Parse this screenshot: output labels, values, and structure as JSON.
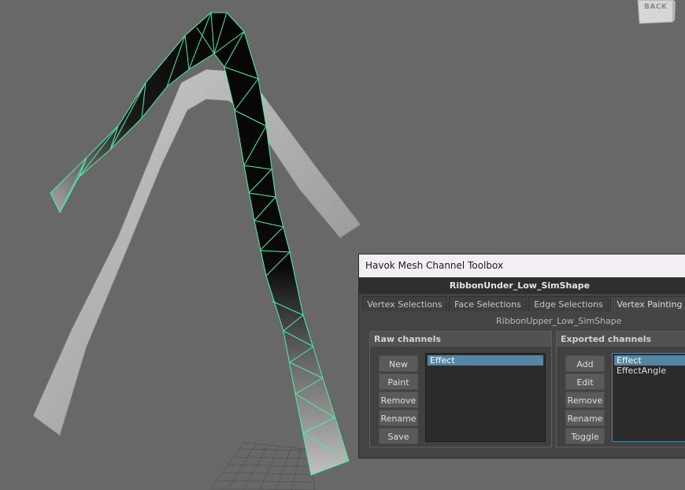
{
  "viewport": {
    "viewcube_label": "BACK"
  },
  "toolbox": {
    "title": "Havok Mesh Channel Toolbox",
    "mesh_name": "RibbonUnder_Low_SimShape",
    "tabs": [
      {
        "label": "Vertex Selections",
        "active": false
      },
      {
        "label": "Face Selections",
        "active": false
      },
      {
        "label": "Edge Selections",
        "active": false
      },
      {
        "label": "Vertex Painting",
        "active": true
      }
    ],
    "sub_mesh": "RibbonUpper_Low_SimShape",
    "raw_channels": {
      "title": "Raw channels",
      "buttons": [
        "New",
        "Paint",
        "Remove",
        "Rename",
        "Save"
      ],
      "items": [
        "Effect"
      ],
      "selected": "Effect"
    },
    "exported_channels": {
      "title": "Exported channels",
      "buttons": [
        "Add",
        "Edit",
        "Remove",
        "Rename",
        "Toggle"
      ],
      "items": [
        "Effect",
        "EffectAngle"
      ],
      "selected": "Effect"
    }
  },
  "colors": {
    "viewport_bg": "#686868",
    "wireframe_selected": "#4bf0a5",
    "selection_highlight": "#5285a6",
    "panel_bg": "#444444"
  }
}
